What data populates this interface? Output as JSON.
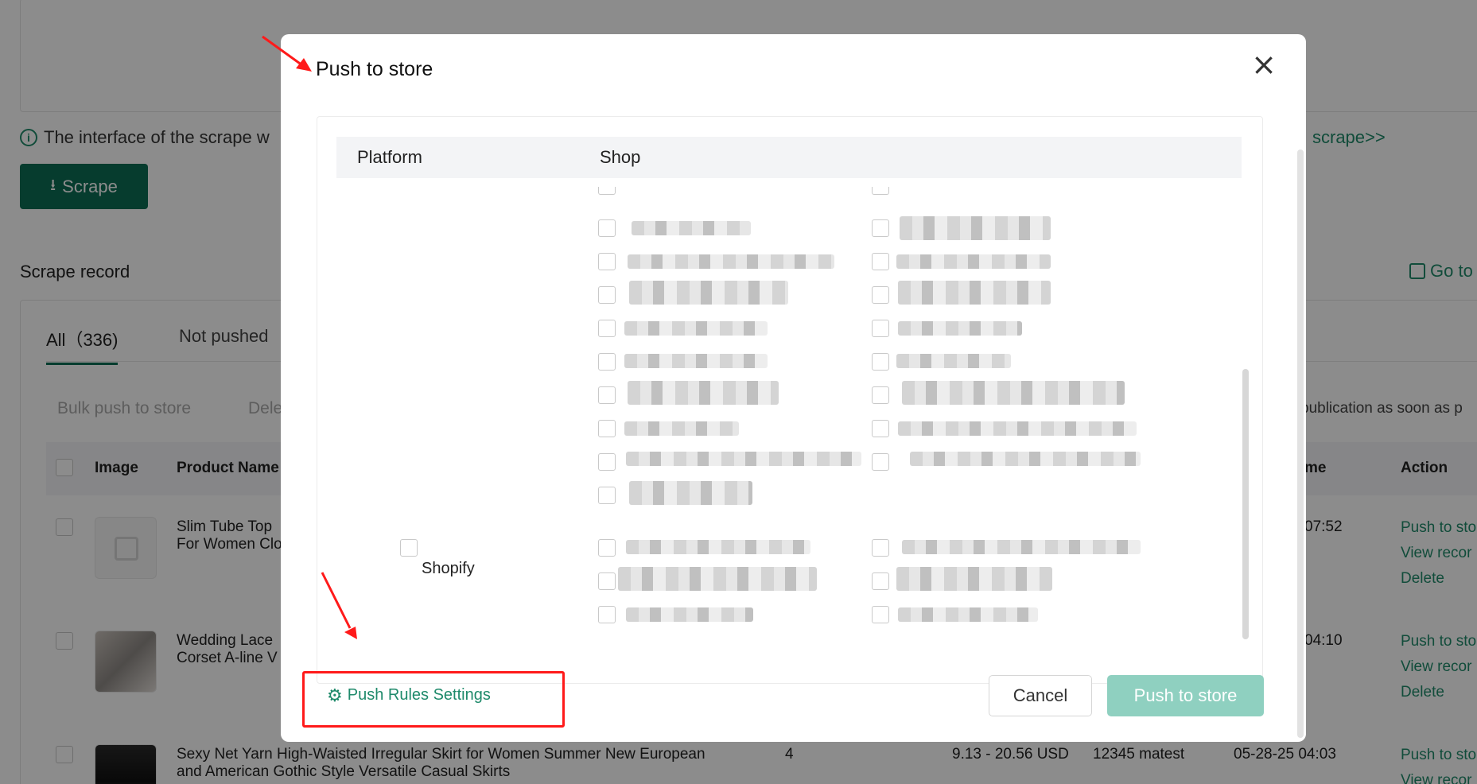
{
  "background": {
    "info_text": "The interface of the scrape w",
    "scrape_link": "scrape>>",
    "scrape_button": "Scrape",
    "record_title": "Scrape record",
    "goto_link": "Go to",
    "tabs": {
      "all": "All（336)",
      "not_pushed": "Not pushed"
    },
    "toolbar": {
      "bulk_push": "Bulk push to store",
      "delete_partial": "Dele",
      "publication_note": "publication as soon as p"
    },
    "columns": {
      "image": "Image",
      "product_name": "Product Name",
      "time": "me",
      "action": "Action"
    },
    "rows": [
      {
        "name": "Slim Tube Top\nFor Women Clo",
        "time": "07:52",
        "actions": [
          "Push to sto",
          "View recor",
          "Delete"
        ]
      },
      {
        "name": "Wedding Lace\nCorset A-line V",
        "time": "04:10",
        "actions": [
          "Push to sto",
          "View recor",
          "Delete"
        ]
      },
      {
        "name": "Sexy Net Yarn High-Waisted Irregular Skirt for Women Summer New European\nand American Gothic Style Versatile Casual Skirts",
        "qty": "4",
        "price": "9.13 - 20.56 USD",
        "shop": "12345 matest",
        "time": "05-28-25 04:03",
        "actions": [
          "Push to sto",
          "View recor"
        ]
      }
    ]
  },
  "modal": {
    "title": "Push to store",
    "headers": {
      "platform": "Platform",
      "shop": "Shop"
    },
    "shopify_label": "Shopify",
    "push_rules_label": "Push Rules Settings",
    "cancel_label": "Cancel",
    "push_label": "Push to store"
  },
  "icons": {
    "close": "close-icon",
    "gear": "gear-icon",
    "info": "info-icon",
    "download": "download-icon"
  },
  "colors": {
    "accent": "#1f8a6b",
    "primary_button": "#0b6e55",
    "disabled_button": "#8fd0c0",
    "annotation": "#ff1a1a"
  }
}
